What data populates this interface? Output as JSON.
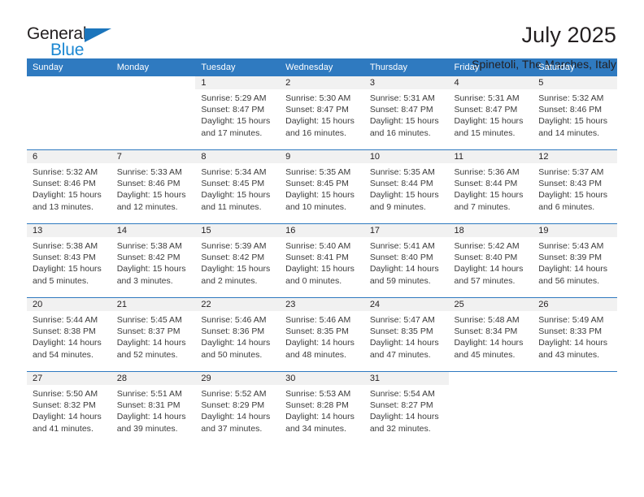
{
  "brand": {
    "name_part1": "General",
    "name_part2": "Blue",
    "triangle_color": "#1b75bc",
    "blue_color": "#1b87d2"
  },
  "header": {
    "title": "July 2025",
    "subtitle": "Spinetoli, The Marches, Italy",
    "accent_color": "#2f7ac0"
  },
  "calendar": {
    "weekday_headers": [
      "Sunday",
      "Monday",
      "Tuesday",
      "Wednesday",
      "Thursday",
      "Friday",
      "Saturday"
    ],
    "labels": {
      "sunrise": "Sunrise:",
      "sunset": "Sunset:",
      "daylight": "Daylight:"
    },
    "weeks": [
      [
        {
          "day": "",
          "blank": true
        },
        {
          "day": "",
          "blank": true
        },
        {
          "day": "1",
          "sunrise": "Sunrise: 5:29 AM",
          "sunset": "Sunset: 8:47 PM",
          "daylight_1": "Daylight: 15 hours",
          "daylight_2": "and 17 minutes."
        },
        {
          "day": "2",
          "sunrise": "Sunrise: 5:30 AM",
          "sunset": "Sunset: 8:47 PM",
          "daylight_1": "Daylight: 15 hours",
          "daylight_2": "and 16 minutes."
        },
        {
          "day": "3",
          "sunrise": "Sunrise: 5:31 AM",
          "sunset": "Sunset: 8:47 PM",
          "daylight_1": "Daylight: 15 hours",
          "daylight_2": "and 16 minutes."
        },
        {
          "day": "4",
          "sunrise": "Sunrise: 5:31 AM",
          "sunset": "Sunset: 8:47 PM",
          "daylight_1": "Daylight: 15 hours",
          "daylight_2": "and 15 minutes."
        },
        {
          "day": "5",
          "sunrise": "Sunrise: 5:32 AM",
          "sunset": "Sunset: 8:46 PM",
          "daylight_1": "Daylight: 15 hours",
          "daylight_2": "and 14 minutes."
        }
      ],
      [
        {
          "day": "6",
          "sunrise": "Sunrise: 5:32 AM",
          "sunset": "Sunset: 8:46 PM",
          "daylight_1": "Daylight: 15 hours",
          "daylight_2": "and 13 minutes."
        },
        {
          "day": "7",
          "sunrise": "Sunrise: 5:33 AM",
          "sunset": "Sunset: 8:46 PM",
          "daylight_1": "Daylight: 15 hours",
          "daylight_2": "and 12 minutes."
        },
        {
          "day": "8",
          "sunrise": "Sunrise: 5:34 AM",
          "sunset": "Sunset: 8:45 PM",
          "daylight_1": "Daylight: 15 hours",
          "daylight_2": "and 11 minutes."
        },
        {
          "day": "9",
          "sunrise": "Sunrise: 5:35 AM",
          "sunset": "Sunset: 8:45 PM",
          "daylight_1": "Daylight: 15 hours",
          "daylight_2": "and 10 minutes."
        },
        {
          "day": "10",
          "sunrise": "Sunrise: 5:35 AM",
          "sunset": "Sunset: 8:44 PM",
          "daylight_1": "Daylight: 15 hours",
          "daylight_2": "and 9 minutes."
        },
        {
          "day": "11",
          "sunrise": "Sunrise: 5:36 AM",
          "sunset": "Sunset: 8:44 PM",
          "daylight_1": "Daylight: 15 hours",
          "daylight_2": "and 7 minutes."
        },
        {
          "day": "12",
          "sunrise": "Sunrise: 5:37 AM",
          "sunset": "Sunset: 8:43 PM",
          "daylight_1": "Daylight: 15 hours",
          "daylight_2": "and 6 minutes."
        }
      ],
      [
        {
          "day": "13",
          "sunrise": "Sunrise: 5:38 AM",
          "sunset": "Sunset: 8:43 PM",
          "daylight_1": "Daylight: 15 hours",
          "daylight_2": "and 5 minutes."
        },
        {
          "day": "14",
          "sunrise": "Sunrise: 5:38 AM",
          "sunset": "Sunset: 8:42 PM",
          "daylight_1": "Daylight: 15 hours",
          "daylight_2": "and 3 minutes."
        },
        {
          "day": "15",
          "sunrise": "Sunrise: 5:39 AM",
          "sunset": "Sunset: 8:42 PM",
          "daylight_1": "Daylight: 15 hours",
          "daylight_2": "and 2 minutes."
        },
        {
          "day": "16",
          "sunrise": "Sunrise: 5:40 AM",
          "sunset": "Sunset: 8:41 PM",
          "daylight_1": "Daylight: 15 hours",
          "daylight_2": "and 0 minutes."
        },
        {
          "day": "17",
          "sunrise": "Sunrise: 5:41 AM",
          "sunset": "Sunset: 8:40 PM",
          "daylight_1": "Daylight: 14 hours",
          "daylight_2": "and 59 minutes."
        },
        {
          "day": "18",
          "sunrise": "Sunrise: 5:42 AM",
          "sunset": "Sunset: 8:40 PM",
          "daylight_1": "Daylight: 14 hours",
          "daylight_2": "and 57 minutes."
        },
        {
          "day": "19",
          "sunrise": "Sunrise: 5:43 AM",
          "sunset": "Sunset: 8:39 PM",
          "daylight_1": "Daylight: 14 hours",
          "daylight_2": "and 56 minutes."
        }
      ],
      [
        {
          "day": "20",
          "sunrise": "Sunrise: 5:44 AM",
          "sunset": "Sunset: 8:38 PM",
          "daylight_1": "Daylight: 14 hours",
          "daylight_2": "and 54 minutes."
        },
        {
          "day": "21",
          "sunrise": "Sunrise: 5:45 AM",
          "sunset": "Sunset: 8:37 PM",
          "daylight_1": "Daylight: 14 hours",
          "daylight_2": "and 52 minutes."
        },
        {
          "day": "22",
          "sunrise": "Sunrise: 5:46 AM",
          "sunset": "Sunset: 8:36 PM",
          "daylight_1": "Daylight: 14 hours",
          "daylight_2": "and 50 minutes."
        },
        {
          "day": "23",
          "sunrise": "Sunrise: 5:46 AM",
          "sunset": "Sunset: 8:35 PM",
          "daylight_1": "Daylight: 14 hours",
          "daylight_2": "and 48 minutes."
        },
        {
          "day": "24",
          "sunrise": "Sunrise: 5:47 AM",
          "sunset": "Sunset: 8:35 PM",
          "daylight_1": "Daylight: 14 hours",
          "daylight_2": "and 47 minutes."
        },
        {
          "day": "25",
          "sunrise": "Sunrise: 5:48 AM",
          "sunset": "Sunset: 8:34 PM",
          "daylight_1": "Daylight: 14 hours",
          "daylight_2": "and 45 minutes."
        },
        {
          "day": "26",
          "sunrise": "Sunrise: 5:49 AM",
          "sunset": "Sunset: 8:33 PM",
          "daylight_1": "Daylight: 14 hours",
          "daylight_2": "and 43 minutes."
        }
      ],
      [
        {
          "day": "27",
          "sunrise": "Sunrise: 5:50 AM",
          "sunset": "Sunset: 8:32 PM",
          "daylight_1": "Daylight: 14 hours",
          "daylight_2": "and 41 minutes."
        },
        {
          "day": "28",
          "sunrise": "Sunrise: 5:51 AM",
          "sunset": "Sunset: 8:31 PM",
          "daylight_1": "Daylight: 14 hours",
          "daylight_2": "and 39 minutes."
        },
        {
          "day": "29",
          "sunrise": "Sunrise: 5:52 AM",
          "sunset": "Sunset: 8:29 PM",
          "daylight_1": "Daylight: 14 hours",
          "daylight_2": "and 37 minutes."
        },
        {
          "day": "30",
          "sunrise": "Sunrise: 5:53 AM",
          "sunset": "Sunset: 8:28 PM",
          "daylight_1": "Daylight: 14 hours",
          "daylight_2": "and 34 minutes."
        },
        {
          "day": "31",
          "sunrise": "Sunrise: 5:54 AM",
          "sunset": "Sunset: 8:27 PM",
          "daylight_1": "Daylight: 14 hours",
          "daylight_2": "and 32 minutes."
        },
        {
          "day": "",
          "blank": true
        },
        {
          "day": "",
          "blank": true
        }
      ]
    ]
  }
}
